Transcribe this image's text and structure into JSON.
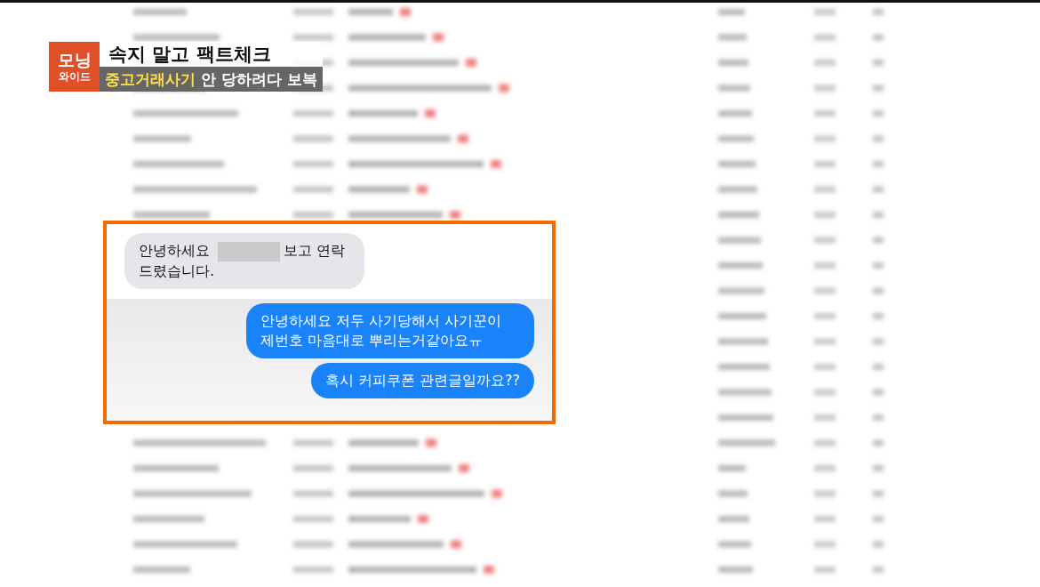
{
  "caption": {
    "badge": [
      "모닝",
      "와이드"
    ],
    "headline": "속지 말고 팩트체크",
    "subhead_highlight": "중고거래사기",
    "subhead_rest": "안 당하려다 보복"
  },
  "chat": {
    "messages": [
      {
        "sent": false,
        "parts": [
          {
            "kind": "text",
            "text": "안녕하세요"
          },
          {
            "kind": "redacted"
          },
          {
            "kind": "text",
            "text": "보고 연락"
          },
          {
            "kind": "text",
            "text": "드렸습니다."
          }
        ]
      },
      {
        "sent": true,
        "parts": [
          {
            "kind": "text",
            "text": "안녕하세요 저두 사기당해서 사기꾼이 제번호 마음대로 뿌리는거같아요ㅠ"
          }
        ]
      },
      {
        "sent": true,
        "parts": [
          {
            "kind": "text",
            "text": "혹시 커피쿠폰 관련글일까요??"
          }
        ]
      }
    ]
  }
}
